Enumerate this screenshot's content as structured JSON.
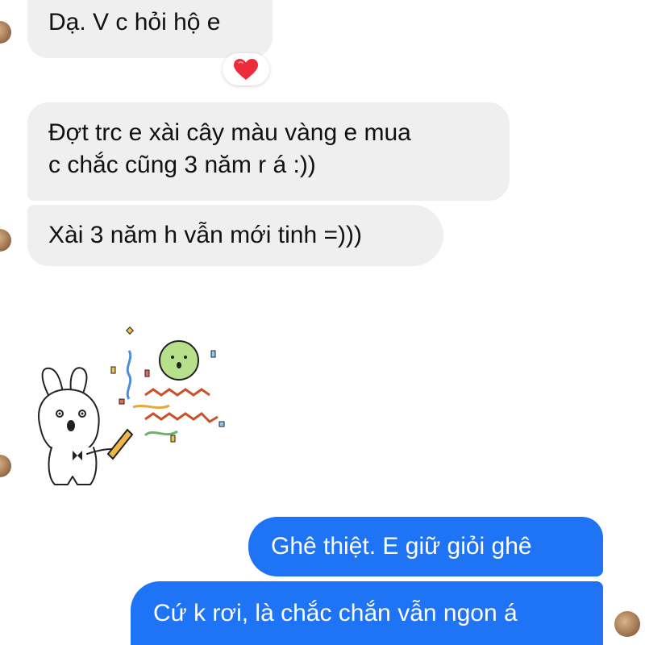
{
  "messages": [
    {
      "side": "incoming",
      "text": "Dạ. V c hỏi hộ e"
    },
    {
      "side": "incoming",
      "lines": [
        "Đợt trc e xài cây màu vàng e mua",
        "c chắc cũng 3 năm r á :))"
      ]
    },
    {
      "side": "incoming",
      "text": "Xài 3 năm h vẫn mới tinh =)))"
    },
    {
      "side": "outgoing",
      "text": "Ghê thiệt. E giữ giỏi ghê"
    },
    {
      "side": "outgoing",
      "text": "Cứ k rơi, là chắc chắn vẫn ngon á"
    }
  ],
  "reaction": {
    "icon": "heart-icon",
    "color": "#ee2b3b"
  },
  "sticker": {
    "icon": "party-bunny-sticker"
  },
  "colors": {
    "incoming_bubble": "#efeff0",
    "outgoing_bubble": "#1f74f5",
    "incoming_text": "#111111",
    "outgoing_text": "#ffffff"
  }
}
